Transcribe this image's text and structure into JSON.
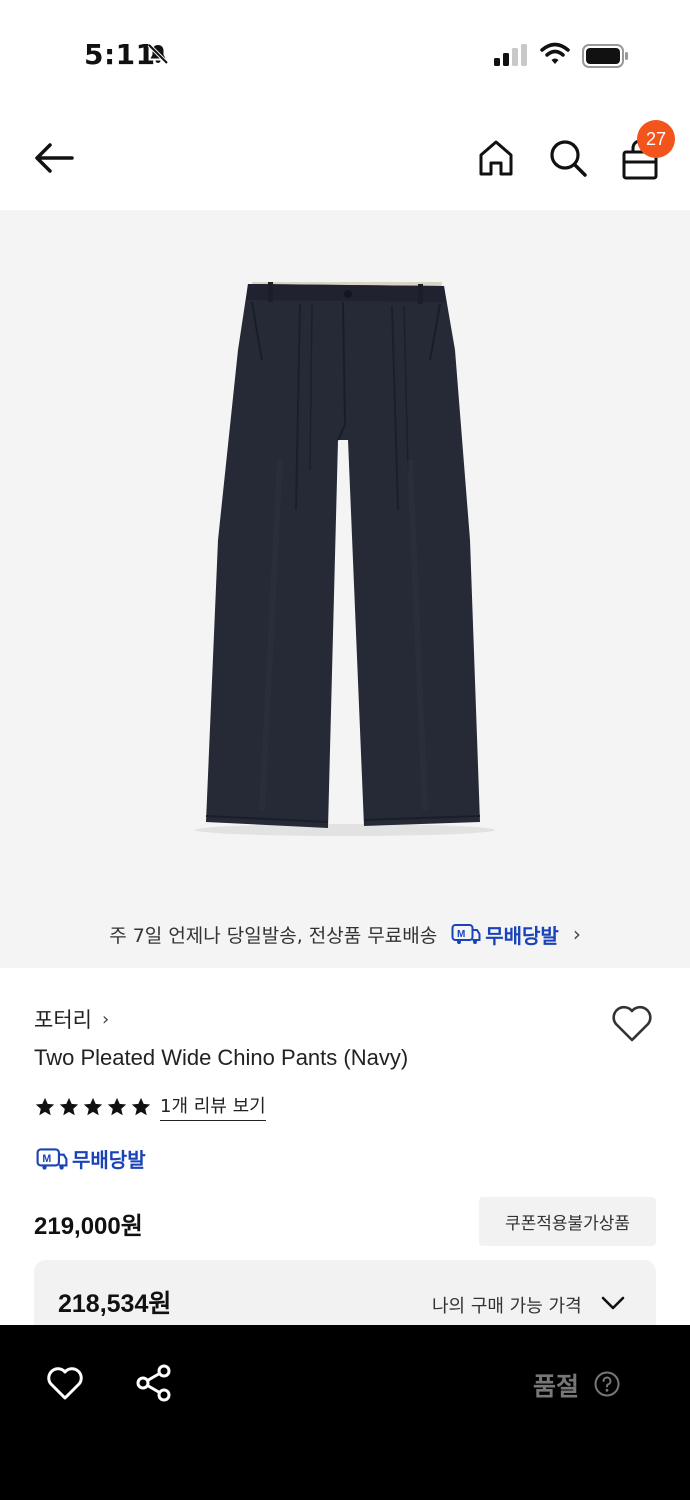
{
  "status_bar": {
    "time": "5:11",
    "icons": [
      "bell-slash-icon",
      "signal-icon",
      "wifi-icon",
      "battery-icon"
    ]
  },
  "header": {
    "cart_count": "27",
    "icons": [
      "back-arrow-icon",
      "home-icon",
      "search-icon",
      "shopping-bag-icon"
    ]
  },
  "banner": {
    "text": "주 7일 언제나 당일발송, 전상품 무료배송",
    "service_name": "무배당발",
    "chevron": "›"
  },
  "product": {
    "brand": "포터리",
    "brand_chevron": "›",
    "title": "Two Pleated Wide Chino Pants (Navy)",
    "rating_stars": 5,
    "review_link": "1개 리뷰 보기",
    "service_badge": "무배당발",
    "price": "219,000원",
    "coupon_label": "쿠폰적용불가상품",
    "my_price": "218,534원",
    "my_price_label": "나의 구매 가능 가격"
  },
  "bottom_bar": {
    "soldout_label": "품절",
    "icons": [
      "heart-icon",
      "share-icon",
      "question-icon"
    ]
  },
  "colors": {
    "accent_orange": "#f2541b",
    "brand_blue": "#1a43b8",
    "pants_navy": "#262a37",
    "bottom_bar": "#000000"
  }
}
